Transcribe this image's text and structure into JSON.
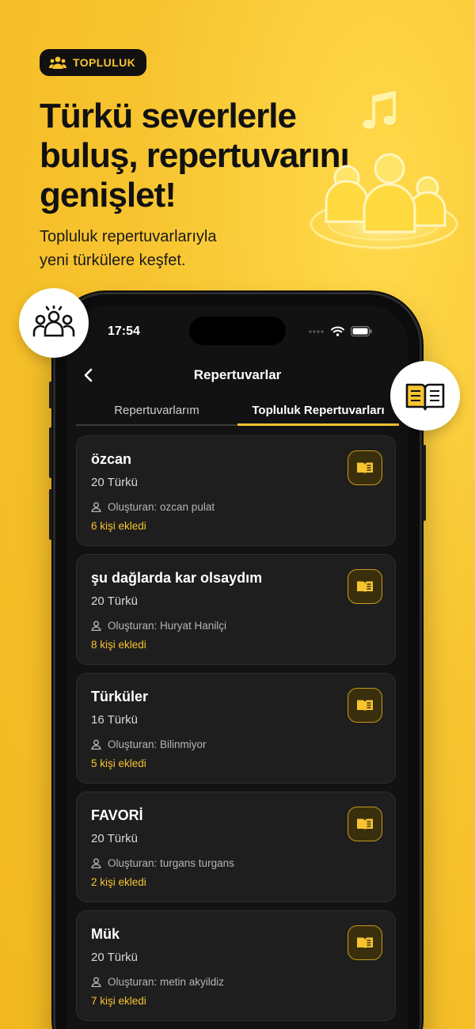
{
  "badge": {
    "icon": "community-icon",
    "label": "TOPLULUK"
  },
  "hero": {
    "title_lines": [
      "Türkü severlerle",
      "buluş, repertuvarını",
      "genişlet!"
    ],
    "subtitle_lines": [
      "Topluluk repertuvarlarıyla",
      "yeni türkülere keşfet."
    ]
  },
  "status_bar": {
    "time": "17:54"
  },
  "nav": {
    "title": "Repertuvarlar"
  },
  "tabs": [
    {
      "label": "Repertuvarlarım",
      "active": false
    },
    {
      "label": "Topluluk Repertuvarları",
      "active": true
    }
  ],
  "repertoires": [
    {
      "title": "özcan",
      "count": "20 Türkü",
      "creator": "Oluşturan: ozcan pulat",
      "added": "6 kişi ekledi"
    },
    {
      "title": "şu dağlarda kar olsaydım",
      "count": "20 Türkü",
      "creator": "Oluşturan: Huryat Hanilçi",
      "added": "8 kişi ekledi"
    },
    {
      "title": "Türküler",
      "count": "16 Türkü",
      "creator": "Oluşturan: Bilinmiyor",
      "added": "5 kişi ekledi"
    },
    {
      "title": "FAVORİ",
      "count": "20 Türkü",
      "creator": "Oluşturan: turgans turgans",
      "added": "2 kişi ekledi"
    },
    {
      "title": "Mük",
      "count": "20 Türkü",
      "creator": "Oluşturan: metin akyildiz",
      "added": "7 kişi ekledi"
    }
  ],
  "colors": {
    "accent": "#f7c430",
    "screen_bg": "#121212",
    "card_bg": "#1e1e1e"
  }
}
